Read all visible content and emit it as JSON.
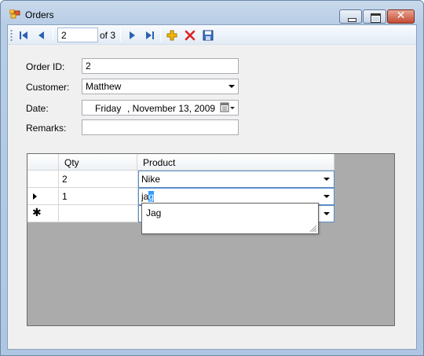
{
  "window": {
    "title": "Orders"
  },
  "nav": {
    "position": "2",
    "of_label": "of 3",
    "buttons": [
      "move-first",
      "move-previous",
      "move-next",
      "move-last",
      "add-new",
      "delete",
      "save"
    ]
  },
  "form": {
    "order_id_label": "Order ID:",
    "order_id_value": "2",
    "customer_label": "Customer:",
    "customer_value": "Matthew",
    "date_label": "Date:",
    "date_day": "Friday",
    "date_rest": ", November 13, 2009",
    "remarks_label": "Remarks:",
    "remarks_value": ""
  },
  "grid": {
    "columns": [
      "Qty",
      "Product"
    ],
    "rows": [
      {
        "qty": "2",
        "product": "Nike"
      },
      {
        "qty": "1",
        "product_typed": "ja",
        "product_selected": "g"
      },
      {
        "qty": "",
        "product": ""
      }
    ],
    "dropdown_items": [
      "Jag"
    ]
  },
  "colors": {
    "grid_background": "#ababab",
    "selection": "#3399ff",
    "delete_red": "#e02020",
    "add_yellow": "#f2b705"
  }
}
